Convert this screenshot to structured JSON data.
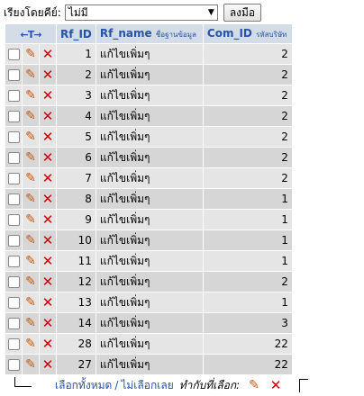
{
  "sort": {
    "label": "เรียงโดยคีย์:",
    "selected": "ไม่มี",
    "button_label": "ลงมือ"
  },
  "table": {
    "arrows": "←T→",
    "headers": {
      "rf_id": "Rf_ID",
      "rf_name": "Rf_name",
      "rf_name_sub": "ชื่อฐานข้อมูล",
      "com_id": "Com_ID",
      "com_id_sub": "รหัสบริษัท"
    },
    "rows": [
      {
        "id": "1",
        "name": "แก้ไขเพิ่มๆ",
        "com": "2"
      },
      {
        "id": "2",
        "name": "แก้ไขเพิ่มๆ",
        "com": "2"
      },
      {
        "id": "3",
        "name": "แก้ไขเพิ่มๆ",
        "com": "2"
      },
      {
        "id": "4",
        "name": "แก้ไขเพิ่มๆ",
        "com": "2"
      },
      {
        "id": "5",
        "name": "แก้ไขเพิ่มๆ",
        "com": "2"
      },
      {
        "id": "6",
        "name": "แก้ไขเพิ่มๆ",
        "com": "2"
      },
      {
        "id": "7",
        "name": "แก้ไขเพิ่มๆ",
        "com": "2"
      },
      {
        "id": "8",
        "name": "แก้ไขเพิ่มๆ",
        "com": "1"
      },
      {
        "id": "9",
        "name": "แก้ไขเพิ่มๆ",
        "com": "1"
      },
      {
        "id": "10",
        "name": "แก้ไขเพิ่มๆ",
        "com": "1"
      },
      {
        "id": "11",
        "name": "แก้ไขเพิ่มๆ",
        "com": "1"
      },
      {
        "id": "12",
        "name": "แก้ไขเพิ่มๆ",
        "com": "2"
      },
      {
        "id": "13",
        "name": "แก้ไขเพิ่มๆ",
        "com": "1"
      },
      {
        "id": "14",
        "name": "แก้ไขเพิ่มๆ",
        "com": "3"
      },
      {
        "id": "28",
        "name": "แก้ไขเพิ่มๆ",
        "com": "22"
      },
      {
        "id": "27",
        "name": "แก้ไขเพิ่มๆ",
        "com": "22"
      }
    ]
  },
  "footer": {
    "select_all": "เลือกทั้งหมด",
    "separator": "/",
    "deselect_all": "ไม่เลือกเลย",
    "with_selected": "ทำกับที่เลือก:"
  },
  "icons": {
    "edit": "pencil-icon",
    "delete": "delete-x-icon",
    "arrow": "bent-arrow-icon"
  },
  "colors": {
    "header_bg": "#d4dce7",
    "header_text": "#2753a8",
    "row_odd": "#e5e5e5",
    "row_even": "#d6d6d6",
    "edit_icon": "#c8580c",
    "delete_icon": "#d00000"
  }
}
